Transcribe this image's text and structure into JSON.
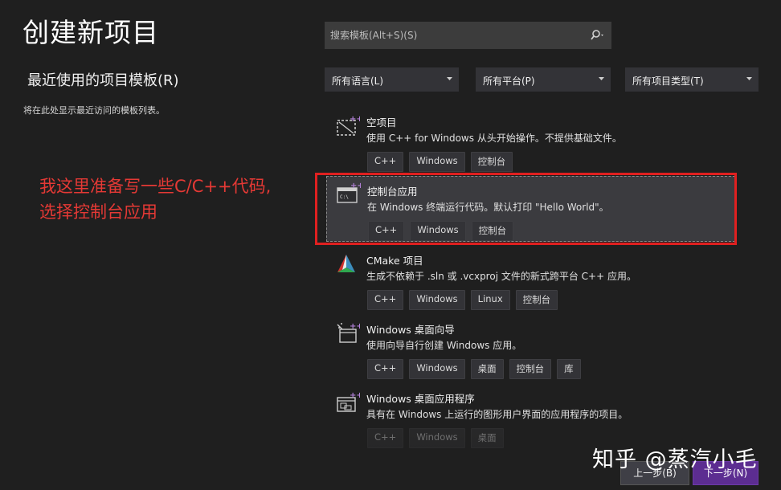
{
  "title": "创建新项目",
  "search": {
    "placeholder": "搜索模板(Alt+S)(S)"
  },
  "recent": {
    "heading": "最近使用的项目模板(R)",
    "empty_text": "将在此处显示最近访问的模板列表。"
  },
  "filters": [
    {
      "label": "所有语言(L)"
    },
    {
      "label": "所有平台(P)"
    },
    {
      "label": "所有项目类型(T)"
    }
  ],
  "templates": [
    {
      "name": "空项目",
      "description": "使用 C++ for Windows 从头开始操作。不提供基础文件。",
      "tags": [
        "C++",
        "Windows",
        "控制台"
      ],
      "icon": "empty-project-icon"
    },
    {
      "name": "控制台应用",
      "description": "在 Windows 终端运行代码。默认打印 \"Hello World\"。",
      "tags": [
        "C++",
        "Windows",
        "控制台"
      ],
      "icon": "console-app-icon",
      "selected": true
    },
    {
      "name": "CMake 项目",
      "description": "生成不依赖于 .sln 或 .vcxproj 文件的新式跨平台 C++ 应用。",
      "tags": [
        "C++",
        "Windows",
        "Linux",
        "控制台"
      ],
      "icon": "cmake-icon"
    },
    {
      "name": "Windows 桌面向导",
      "description": "使用向导自行创建 Windows 应用。",
      "tags": [
        "C++",
        "Windows",
        "桌面",
        "控制台",
        "库"
      ],
      "icon": "desktop-wizard-icon"
    },
    {
      "name": "Windows 桌面应用程序",
      "description": "具有在 Windows 上运行的图形用户界面的应用程序的项目。",
      "tags": [
        "C++",
        "Windows",
        "桌面"
      ],
      "icon": "desktop-app-icon"
    }
  ],
  "annotation": {
    "line1": "我这里准备写一些C/C++代码,",
    "line2": "选择控制台应用"
  },
  "watermark": "知乎 @蒸汽小毛",
  "buttons": {
    "back": "上一步(B)",
    "next": "下一步(N)"
  },
  "colors": {
    "accent": "#5c2d91",
    "annotation": "#e53935",
    "background": "#1f1f1f"
  }
}
